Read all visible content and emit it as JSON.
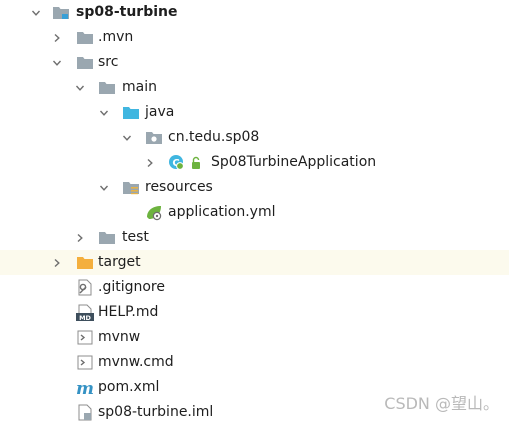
{
  "project_tree": {
    "root": {
      "label": "sp08-turbine",
      "expanded": true,
      "icon": "module-folder-icon"
    },
    "mvn": {
      "label": ".mvn",
      "expanded": false,
      "icon": "folder-icon"
    },
    "src": {
      "label": "src",
      "expanded": true,
      "icon": "folder-icon"
    },
    "main": {
      "label": "main",
      "expanded": true,
      "icon": "folder-icon"
    },
    "java": {
      "label": "java",
      "expanded": true,
      "icon": "source-root-folder-icon"
    },
    "package": {
      "label": "cn.tedu.sp08",
      "expanded": true,
      "icon": "package-icon"
    },
    "app_class": {
      "label": "Sp08TurbineApplication",
      "expanded": false,
      "icon": "spring-boot-class-icon"
    },
    "resources": {
      "label": "resources",
      "expanded": true,
      "icon": "resources-folder-icon"
    },
    "application_yml": {
      "label": "application.yml",
      "icon": "spring-config-file-icon"
    },
    "test": {
      "label": "test",
      "expanded": false,
      "icon": "folder-icon"
    },
    "target": {
      "label": "target",
      "expanded": false,
      "icon": "excluded-folder-icon"
    },
    "gitignore": {
      "label": ".gitignore",
      "icon": "gitignore-file-icon"
    },
    "help_md": {
      "label": "HELP.md",
      "icon": "markdown-file-icon"
    },
    "mvnw": {
      "label": "mvnw",
      "icon": "script-file-icon"
    },
    "mvnw_cmd": {
      "label": "mvnw.cmd",
      "icon": "script-file-icon"
    },
    "pom_xml": {
      "label": "pom.xml",
      "icon": "maven-file-icon"
    },
    "iml": {
      "label": "sp08-turbine.iml",
      "icon": "iml-file-icon"
    }
  },
  "colors": {
    "highlight_row": "#fcfaed",
    "folder_gray": "#9aa7b0",
    "source_blue": "#40b6e0",
    "excluded_orange": "#f4af3d",
    "spring_green": "#6db33f",
    "maven_blue": "#3592c4"
  },
  "watermark": "CSDN @望山。"
}
